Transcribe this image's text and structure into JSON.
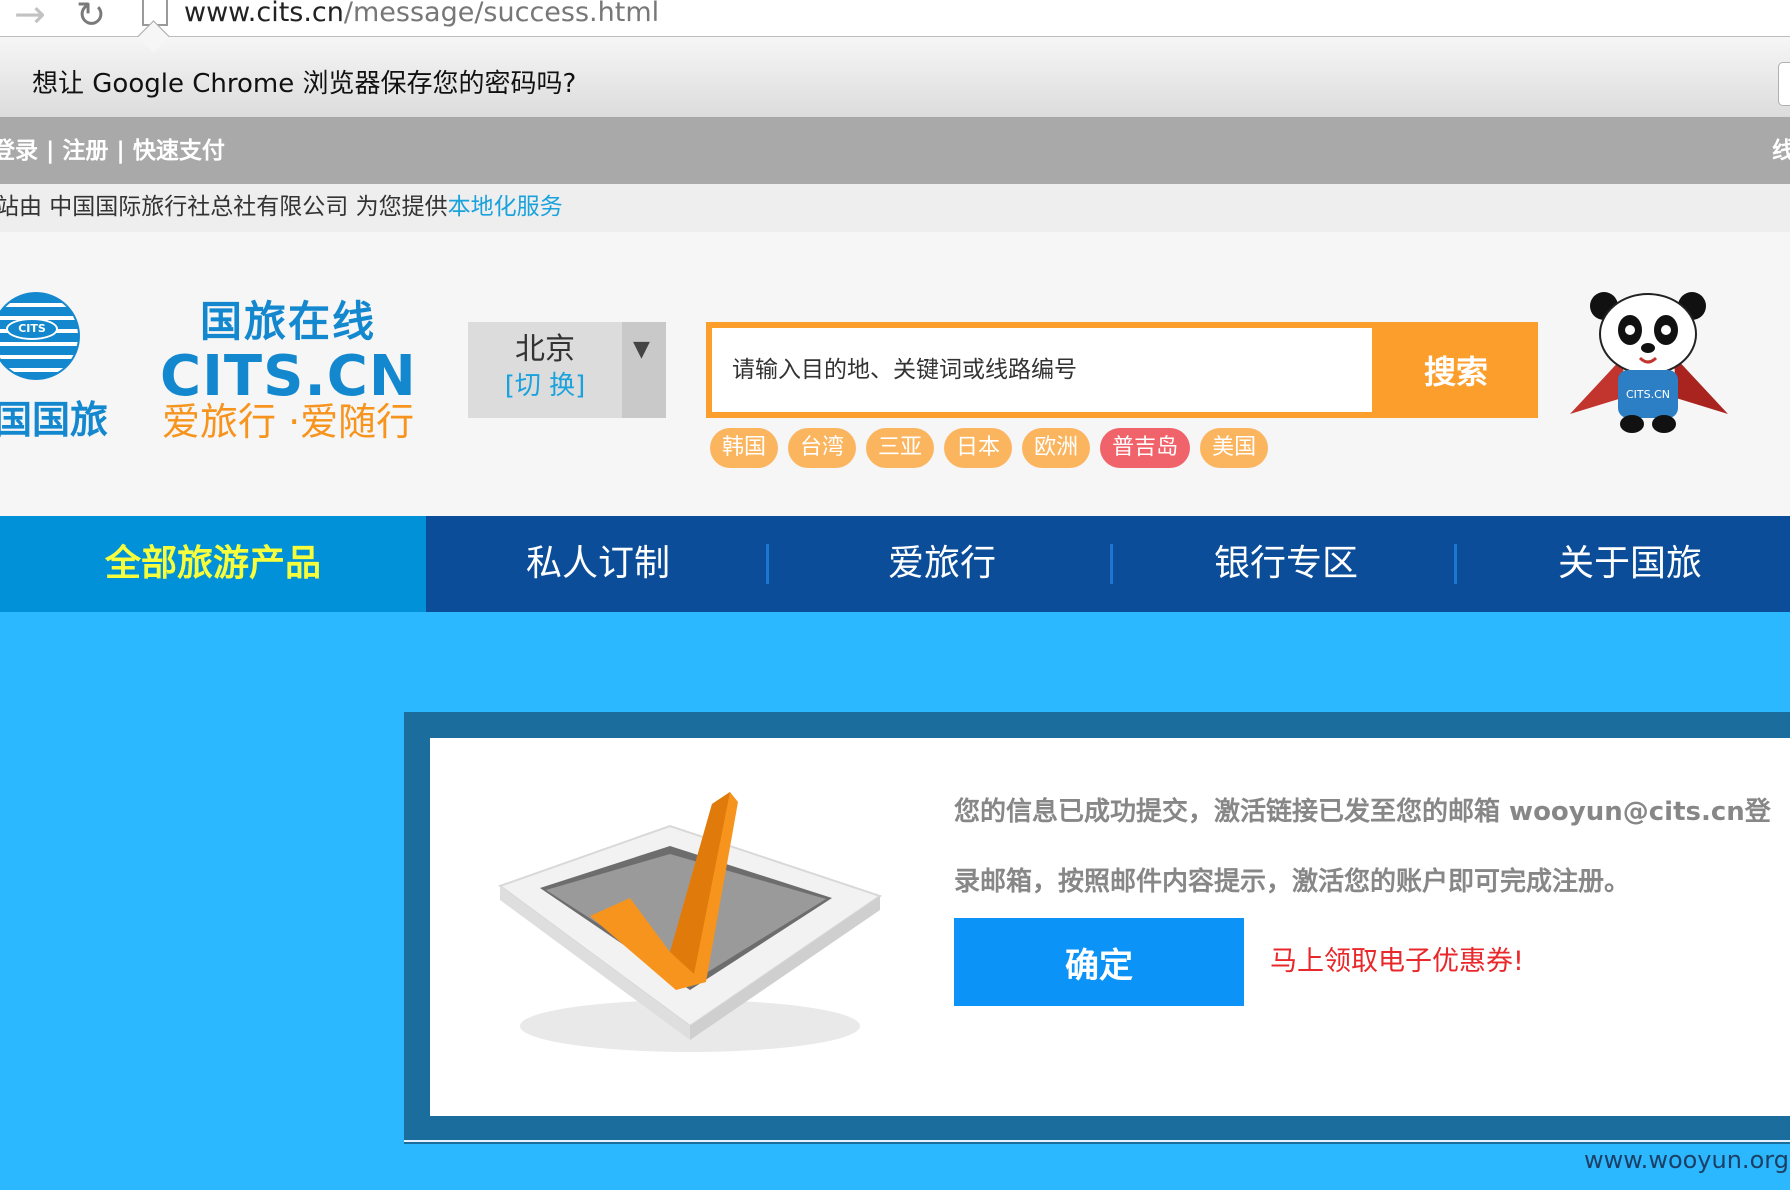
{
  "browser": {
    "url_domain": "www.cits.cn",
    "url_path": "/message/success.html",
    "infobar_text": "想让 Google Chrome 浏览器保存您的密码吗?",
    "icons": [
      "back-arrow-icon",
      "reload-icon",
      "page-icon"
    ]
  },
  "topbar": {
    "links": "登录 | 注册 | 快速支付",
    "right_text": "线"
  },
  "substation": {
    "prefix": "站由 中国国际旅行社总社有限公司 为您提供",
    "highlight": "本地化服务"
  },
  "logo": {
    "globe_label": "CITS",
    "cn_small": "国国旅",
    "cn_title": "国旅在线",
    "en": "CITS.CN",
    "slogan": "爱旅行 ·爱随行"
  },
  "city": {
    "name": "北京",
    "switch_label": "[切 换]"
  },
  "search": {
    "placeholder": "请输入目的地、关键词或线路编号",
    "button": "搜索",
    "tags": [
      {
        "label": "韩国",
        "hot": false
      },
      {
        "label": "台湾",
        "hot": false
      },
      {
        "label": "三亚",
        "hot": false
      },
      {
        "label": "日本",
        "hot": false
      },
      {
        "label": "欧洲",
        "hot": false
      },
      {
        "label": "普吉岛",
        "hot": true
      },
      {
        "label": "美国",
        "hot": false
      }
    ]
  },
  "mascot": {
    "badge_text": "CITS.CN"
  },
  "nav": {
    "all_products": "全部旅游产品",
    "items": [
      "私人订制",
      "爱旅行",
      "银行专区",
      "关于国旅"
    ]
  },
  "success": {
    "message_line1": "您的信息已成功提交，激活链接已发至您的邮箱 wooyun@cits.cn登",
    "message_line2": "录邮箱，按照邮件内容提示，激活您的账户即可完成注册。",
    "ok_button": "确定",
    "coupon_link": "马上领取电子优惠券!"
  },
  "watermark": "www.wooyun.org",
  "colors": {
    "page_bg": "#2bb8ff",
    "nav_bg": "#0c4d9a",
    "nav_active_bg": "#0091d8",
    "search_orange": "#fb9e2c",
    "brand_blue": "#1488cf",
    "ok_button": "#0b93f7",
    "coupon_red": "#e8282b"
  }
}
